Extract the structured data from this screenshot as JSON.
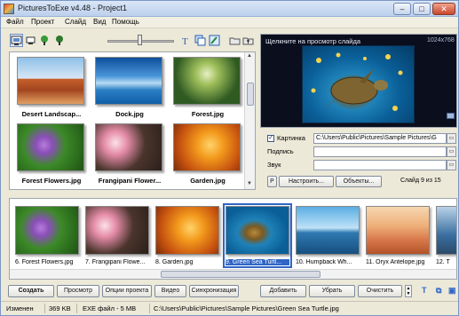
{
  "window": {
    "title": "PicturesToExe v4.48 - Project1",
    "controls": {
      "minimize": "–",
      "maximize": "□",
      "close": "✕"
    }
  },
  "menu": [
    "Файл",
    "Проект",
    "Слайд",
    "Вид",
    "Помощь"
  ],
  "toolbar": {
    "view_buttons": [
      "view-large-icon",
      "view-small-icon",
      "view-list-icon",
      "view-details-icon"
    ],
    "slider_value": 0.46,
    "right_icons": [
      "text-icon",
      "copy-icon",
      "edit-icon",
      "open-folder-icon",
      "folder-up-icon"
    ]
  },
  "thumbnails": [
    {
      "caption": "Desert Landscap...",
      "colors": [
        "#d9723d",
        "#7a3a1c",
        "#e8b07a"
      ]
    },
    {
      "caption": "Dock.jpg",
      "colors": [
        "#1a6fc0",
        "#8cc6f0",
        "#e8f4fb"
      ]
    },
    {
      "caption": "Forest.jpg",
      "colors": [
        "#2e5a22",
        "#8bb14a",
        "#dfe8b0"
      ]
    },
    {
      "caption": "Forest Flowers.jpg",
      "colors": [
        "#2c6e1d",
        "#9c5fc7",
        "#5fa33c"
      ]
    },
    {
      "caption": "Frangipani Flower...",
      "colors": [
        "#3a2a25",
        "#f2c4d0",
        "#d87f9c"
      ]
    },
    {
      "caption": "Garden.jpg",
      "colors": [
        "#e7860f",
        "#f8b23a",
        "#b0420e"
      ]
    }
  ],
  "preview": {
    "label": "Щелкните на просмотр слайда",
    "resolution": "1024x768"
  },
  "properties": {
    "picture": {
      "label": "Картинка",
      "checked": true,
      "value": "C:\\Users\\Public\\Pictures\\Sample Pictures\\G"
    },
    "caption": {
      "label": "Подпись",
      "value": ""
    },
    "sound": {
      "label": "Звук",
      "value": ""
    },
    "p_button": "P",
    "settings_button": "Настроить...",
    "objects_button": "Объекты...",
    "slide_info": "Слайд 9 из 15"
  },
  "filmstrip": [
    {
      "caption": "6. Forest Flowers.jpg",
      "selected": false,
      "colors": [
        "#2c6e1d",
        "#9c5fc7",
        "#5fa33c"
      ]
    },
    {
      "caption": "7. Frangipani Flowe...",
      "selected": false,
      "colors": [
        "#3a2a25",
        "#f2c4d0",
        "#d87f9c"
      ]
    },
    {
      "caption": "8. Garden.jpg",
      "selected": false,
      "colors": [
        "#e7860f",
        "#f8b23a",
        "#b0420e"
      ]
    },
    {
      "caption": "9. Green Sea Turtl...",
      "selected": true,
      "colors": [
        "#0b6fa8",
        "#3cb1d8",
        "#c9a23a"
      ]
    },
    {
      "caption": "10. Humpback Wh...",
      "selected": false,
      "colors": [
        "#4a9ed6",
        "#bfe2f7",
        "#1a4a72"
      ]
    },
    {
      "caption": "11. Oryx Antelope.jpg",
      "selected": false,
      "colors": [
        "#d7784a",
        "#f1c494",
        "#c05a2e"
      ]
    },
    {
      "caption": "12. T",
      "selected": false,
      "colors": [
        "#3a6fa0",
        "#b9d2e8",
        "#2c4a6a"
      ]
    }
  ],
  "bottom_buttons": {
    "create": "Создать",
    "preview": "Просмотр",
    "project_options": "Опции проекта",
    "video": "Видео",
    "sync": "Синхронизация",
    "add": "Добавить",
    "remove": "Убрать",
    "clear": "Очистить"
  },
  "status": {
    "state": "Изменен",
    "size": "369 KB",
    "exe": "EXE файл - 5 MB",
    "path": "C:\\Users\\Public\\Pictures\\Sample Pictures\\Green Sea Turtle.jpg"
  }
}
